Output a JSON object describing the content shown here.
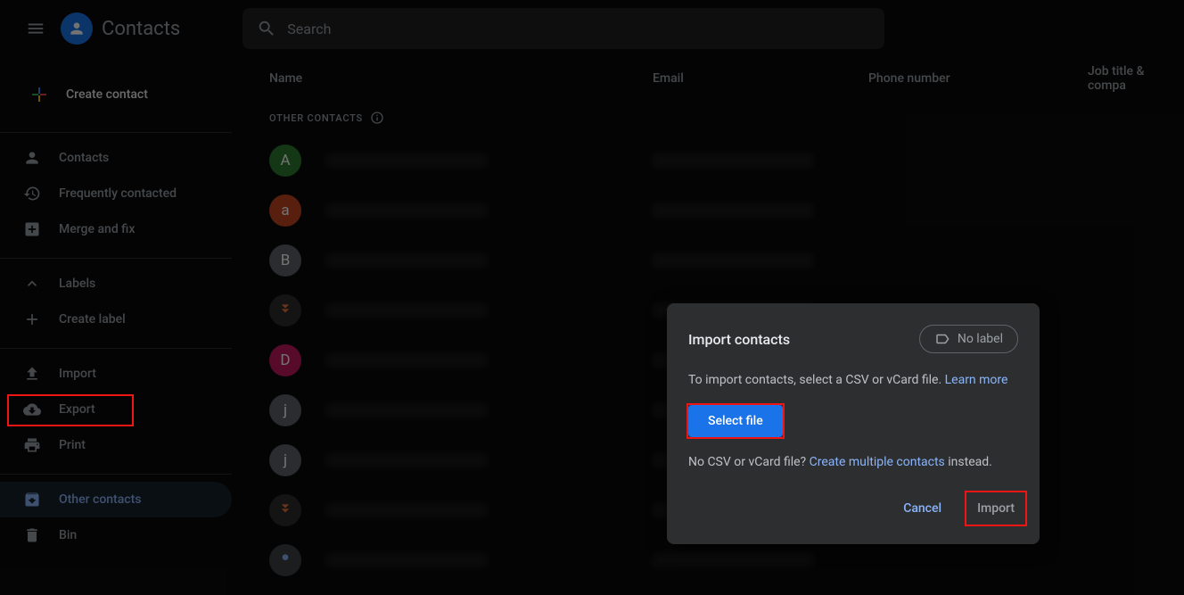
{
  "app": {
    "title": "Contacts"
  },
  "search": {
    "placeholder": "Search"
  },
  "sidebar": {
    "create_label": "Create contact",
    "items": [
      {
        "label": "Contacts"
      },
      {
        "label": "Frequently contacted"
      },
      {
        "label": "Merge and fix"
      }
    ],
    "labels_label": "Labels",
    "create_label_btn": "Create label",
    "import_label": "Import",
    "export_label": "Export",
    "print_label": "Print",
    "other_contacts_label": "Other contacts",
    "bin_label": "Bin"
  },
  "columns": {
    "name": "Name",
    "email": "Email",
    "phone": "Phone number",
    "job": "Job title & compa"
  },
  "section": {
    "other_contacts": "OTHER CONTACTS"
  },
  "contacts": [
    {
      "initial": "A",
      "color": "#2e7d32"
    },
    {
      "initial": "a",
      "color": "#c5461f"
    },
    {
      "initial": "B",
      "color": "#5f6368"
    },
    {
      "initial": "",
      "color": "#2d2d2d",
      "chevron": true
    },
    {
      "initial": "D",
      "color": "#c2185b"
    },
    {
      "initial": "j",
      "color": "#5f6368"
    },
    {
      "initial": "j",
      "color": "#5f6368"
    },
    {
      "initial": "",
      "color": "#2d2d2d",
      "chevron": true
    },
    {
      "initial": "",
      "color": "#3c4043",
      "photo": true
    }
  ],
  "dialog": {
    "title": "Import contacts",
    "no_label": "No label",
    "instruction_prefix": "To import contacts, select a CSV or vCard file. ",
    "learn_more": "Learn more",
    "select_file": "Select file",
    "no_csv_prefix": "No CSV or vCard file? ",
    "create_multiple": "Create multiple contacts",
    "no_csv_suffix": " instead.",
    "cancel": "Cancel",
    "import": "Import"
  }
}
